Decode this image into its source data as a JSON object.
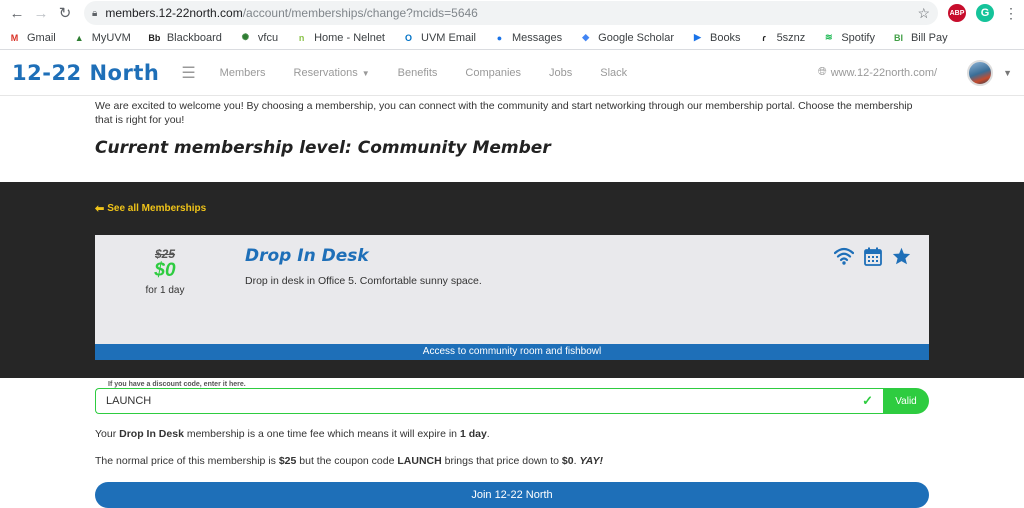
{
  "browser": {
    "url_host": "members.12-22north.com",
    "url_path": "/account/memberships/change?mcids=5646",
    "extension_abp": "ABP",
    "extension_grammarly": "G"
  },
  "bookmarks": [
    {
      "label": "Gmail",
      "icon": "gmail-icon",
      "color": "#d93025",
      "glyph": "M"
    },
    {
      "label": "MyUVM",
      "icon": "tree-icon",
      "color": "#2e7d32",
      "glyph": "▲"
    },
    {
      "label": "Blackboard",
      "icon": "blackboard-icon",
      "color": "#222222",
      "glyph": "Bb"
    },
    {
      "label": "vfcu",
      "icon": "vfcu-icon",
      "color": "#2e7d32",
      "glyph": "✺"
    },
    {
      "label": "Home - Nelnet",
      "icon": "nelnet-icon",
      "color": "#8bc34a",
      "glyph": "n"
    },
    {
      "label": "UVM Email",
      "icon": "outlook-icon",
      "color": "#0072c6",
      "glyph": "O"
    },
    {
      "label": "Messages",
      "icon": "messages-icon",
      "color": "#1a73e8",
      "glyph": "●"
    },
    {
      "label": "Google Scholar",
      "icon": "scholar-icon",
      "color": "#4285f4",
      "glyph": "◆"
    },
    {
      "label": "Books",
      "icon": "play-books-icon",
      "color": "#1a73e8",
      "glyph": "▶"
    },
    {
      "label": "5sznz",
      "icon": "5sznz-icon",
      "color": "#222222",
      "glyph": "ɾ"
    },
    {
      "label": "Spotify",
      "icon": "spotify-icon",
      "color": "#1db954",
      "glyph": "≋"
    },
    {
      "label": "Bill Pay",
      "icon": "bill-pay-icon",
      "color": "#43a047",
      "glyph": "BI"
    }
  ],
  "header": {
    "logo": "12-22 North",
    "nav": [
      "Members",
      "Reservations",
      "Benefits",
      "Companies",
      "Jobs",
      "Slack"
    ],
    "site_url": "www.12-22north.com/"
  },
  "intro": {
    "text": "We are excited to welcome you! By choosing a membership, you can connect with the community and start networking through our membership portal. Choose the membership that is right for you!",
    "current_level": "Current membership level: Community Member"
  },
  "see_all": "See all Memberships",
  "plan": {
    "old_price": "$25",
    "new_price": "$0",
    "period": "for 1 day",
    "title": "Drop In Desk",
    "description": "Drop in desk in Office 5. Comfortable sunny space.",
    "amenities": [
      "wifi-icon",
      "calendar-icon",
      "star-icon"
    ],
    "footer": "Access to community room and fishbowl"
  },
  "coupon": {
    "label": "If you have a discount code, enter it here.",
    "value": "LAUNCH",
    "button": "Valid"
  },
  "details": {
    "line1_a": "Your ",
    "line1_plan": "Drop In Desk",
    "line1_b": " membership is a one time fee which means it will expire in ",
    "line1_exp": "1 day",
    "line1_c": ".",
    "line2_a": "The normal price of this membership is ",
    "line2_price": "$25",
    "line2_b": " but the coupon code ",
    "line2_code": "LAUNCH",
    "line2_c": " brings that price down to ",
    "line2_new": "$0",
    "line2_d": ". ",
    "line2_yay": "YAY!"
  },
  "join_button": "Join 12-22 North",
  "colors": {
    "brand_blue": "#1e6fb8",
    "accent_yellow": "#f0c419",
    "success_green": "#2ecc40",
    "dark_band": "#262626"
  }
}
